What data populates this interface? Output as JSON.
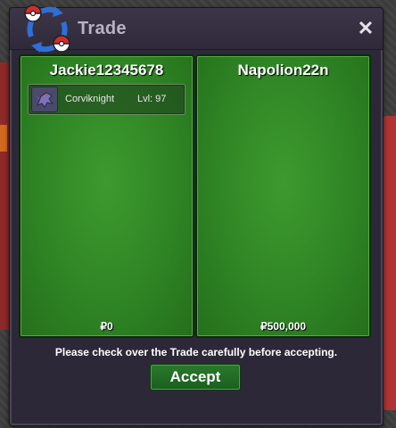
{
  "window": {
    "title": "Trade",
    "close_symbol": "✕"
  },
  "left_panel": {
    "player_name": "Jackie12345678",
    "money": "₽0",
    "items": [
      {
        "name": "Corviknight",
        "level": "Lvl: 97",
        "icon": "corviknight-sprite-icon"
      }
    ]
  },
  "right_panel": {
    "player_name": "Napolion22n",
    "money": "₽500,000",
    "items": []
  },
  "footer": {
    "notice": "Please check over the Trade carefully before accepting.",
    "accept_label": "Accept"
  },
  "colors": {
    "panel_green": "#2f8524",
    "dialog_bg": "#2d2838",
    "title_text": "#b7b3c4",
    "accept_green": "#1b5e1f"
  }
}
